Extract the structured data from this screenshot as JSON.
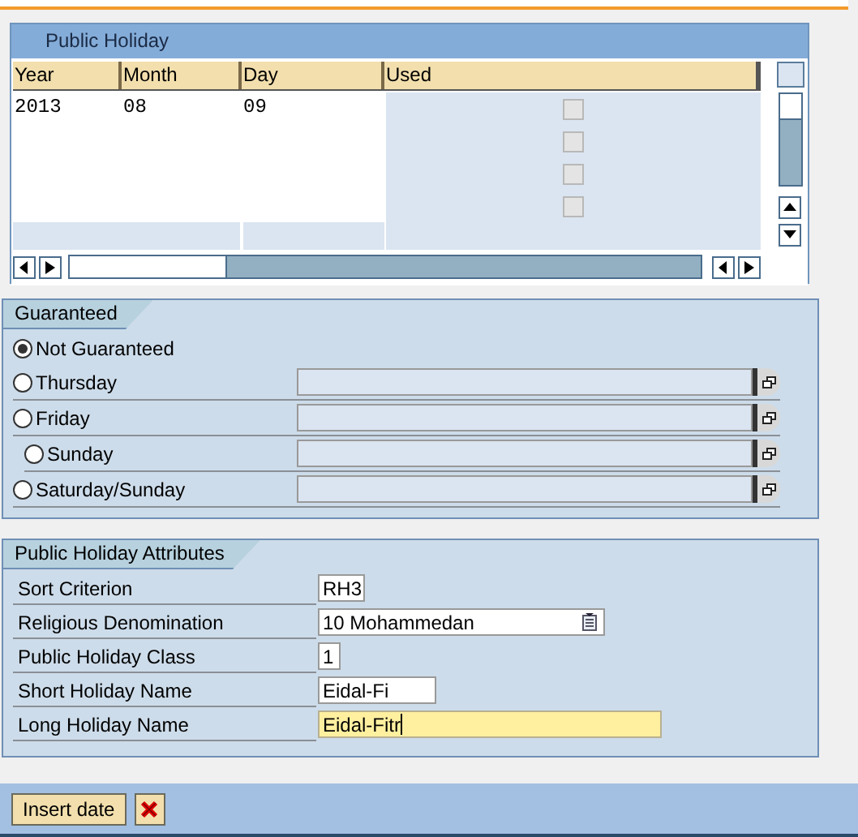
{
  "table": {
    "title": "Public Holiday",
    "columns": [
      "Year",
      "Month",
      "Day",
      "Used"
    ],
    "rows": [
      {
        "year": "2013",
        "month": "08",
        "day": "09",
        "used": false
      },
      {
        "used": false
      },
      {
        "used": false
      },
      {
        "used": false
      }
    ]
  },
  "guaranteed": {
    "title": "Guaranteed",
    "options": [
      {
        "label": "Not Guaranteed",
        "selected": true,
        "kind": "plain"
      },
      {
        "label": "Thursday",
        "selected": false,
        "kind": "field"
      },
      {
        "label": "Friday",
        "selected": false,
        "kind": "field"
      },
      {
        "label": "Sunday",
        "selected": false,
        "kind": "subfield"
      },
      {
        "label": "Saturday/Sunday",
        "selected": false,
        "kind": "field"
      }
    ]
  },
  "attributes": {
    "title": "Public Holiday Attributes",
    "fields": [
      {
        "label": "Sort Criterion",
        "value": "RH3",
        "kind": "text",
        "focused": false
      },
      {
        "label": "Religious Denomination",
        "value": "10 Mohammedan",
        "kind": "dropdown",
        "focused": false
      },
      {
        "label": "Public Holiday Class",
        "value": "1",
        "kind": "text",
        "focused": false
      },
      {
        "label": "Short Holiday Name",
        "value": "Eidal-Fi",
        "kind": "text",
        "focused": false
      },
      {
        "label": "Long Holiday Name",
        "value": "Eidal-Fitr",
        "kind": "text",
        "focused": true
      }
    ]
  },
  "buttons": [
    {
      "label": "Insert date",
      "kind": "text"
    },
    {
      "kind": "cancel"
    }
  ]
}
